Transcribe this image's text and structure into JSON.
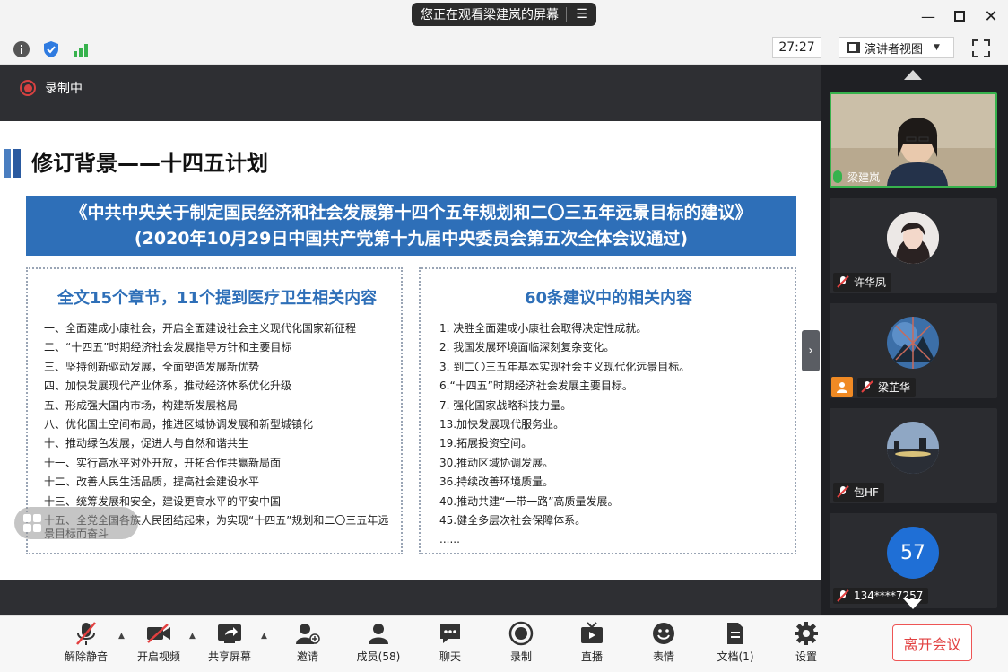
{
  "titlebar": {
    "share_notice": "您正在观看梁建岚的屏幕",
    "menu_icon": "menu-lines-icon"
  },
  "toolbar": {
    "timer": "27:27",
    "view_mode": "演讲者视图"
  },
  "recording": {
    "label": "录制中"
  },
  "slide": {
    "title": "修订背景——十四五计划",
    "banner_line1": "《中共中央关于制定国民经济和社会发展第十四个五年规划和二〇三五年远景目标的建议》",
    "banner_line2": "(2020年10月29日中国共产党第十九届中央委员会第五次全体会议通过)",
    "left_heading": "全文15个章节，11个提到医疗卫生相关内容",
    "left_items": [
      "一、全面建成小康社会，开启全面建设社会主义现代化国家新征程",
      "二、“十四五”时期经济社会发展指导方针和主要目标",
      "三、坚持创新驱动发展，全面塑造发展新优势",
      "四、加快发展现代产业体系，推动经济体系优化升级",
      "五、形成强大国内市场，构建新发展格局",
      "八、优化国土空间布局，推进区域协调发展和新型城镇化",
      "十、推动绿色发展，促进人与自然和谐共生",
      "十一、实行高水平对外开放，开拓合作共赢新局面",
      "十二、改善人民生活品质，提高社会建设水平",
      "十三、统筹发展和安全，建设更高水平的平安中国",
      "十五、全党全国各族人民团结起来，为实现“十四五”规划和二〇三五年远景目标而奋斗"
    ],
    "right_heading": "60条建议中的相关内容",
    "right_items": [
      "1. 决胜全面建成小康社会取得决定性成就。",
      "2. 我国发展环境面临深刻复杂变化。",
      "3. 到二〇三五年基本实现社会主义现代化远景目标。",
      "6.“十四五”时期经济社会发展主要目标。",
      "7. 强化国家战略科技力量。",
      "13.加快发展现代服务业。",
      "19.拓展投资空间。",
      "30.推动区域协调发展。",
      "36.持续改善环境质量。",
      "40.推动共建“一带一路”高质量发展。",
      "45.健全多层次社会保障体系。",
      "......"
    ]
  },
  "participants": [
    {
      "name": "梁建岚",
      "mic": "on"
    },
    {
      "name": "许华凤",
      "mic": "off"
    },
    {
      "name": "梁芷华",
      "mic": "off"
    },
    {
      "name": "包HF",
      "mic": "off"
    },
    {
      "name": "134****7257",
      "mic": "off",
      "avatar_text": "57"
    }
  ],
  "controls": {
    "mute": "解除静音",
    "video": "开启视频",
    "share": "共享屏幕",
    "invite": "邀请",
    "members": "成员(58)",
    "chat": "聊天",
    "record": "录制",
    "live": "直播",
    "emoji": "表情",
    "docs": "文档(1)",
    "settings": "设置",
    "leave": "离开会议"
  },
  "colors": {
    "accent_blue": "#2e6fb8",
    "recording_red": "#d64141",
    "leave_red": "#e24040",
    "active_green": "#37b24d"
  }
}
